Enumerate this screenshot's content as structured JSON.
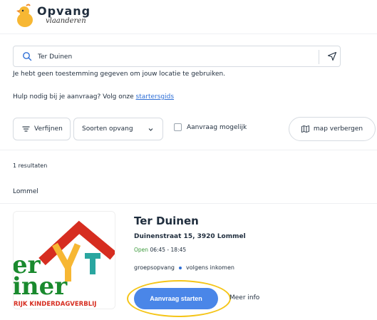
{
  "header": {
    "logo_main": "Opvang",
    "logo_sub": "vlaanderen"
  },
  "search": {
    "value": "Ter Duinen",
    "placeholder": ""
  },
  "location_message": "Je hebt geen toestemming gegeven om jouw locatie te gebruiken.",
  "help": {
    "text": "Hulp nodig bij je aanvraag? Volg onze ",
    "link": "startersgids"
  },
  "filters": {
    "refine_label": "Verfijnen",
    "types_label": "Soorten opvang",
    "request_possible_label": "Aanvraag mogelijk",
    "map_label": "map verbergen"
  },
  "results": {
    "count_text": "1 resultaten",
    "city": "Lommel",
    "items": [
      {
        "name": "Ter Duinen",
        "address": "Duinenstraat 15, 3920 Lommel",
        "status": "Open",
        "hours": "06:45 - 18:45",
        "tag1": "groepsopvang",
        "tag2": "volgens inkomen",
        "cta_label": "Aanvraag starten",
        "more_label": "Meer info",
        "thumb_text_top": "er",
        "thumb_text_mid": "iner",
        "thumb_caption": "RIJK KINDERDAGVERBLIJ"
      }
    ]
  },
  "colors": {
    "accent": "#4a86e8",
    "link": "#2f6fd6",
    "open": "#3c9a3c",
    "highlight": "#f5c518",
    "logo_red": "#d62d20",
    "logo_green": "#1a8a2e"
  }
}
